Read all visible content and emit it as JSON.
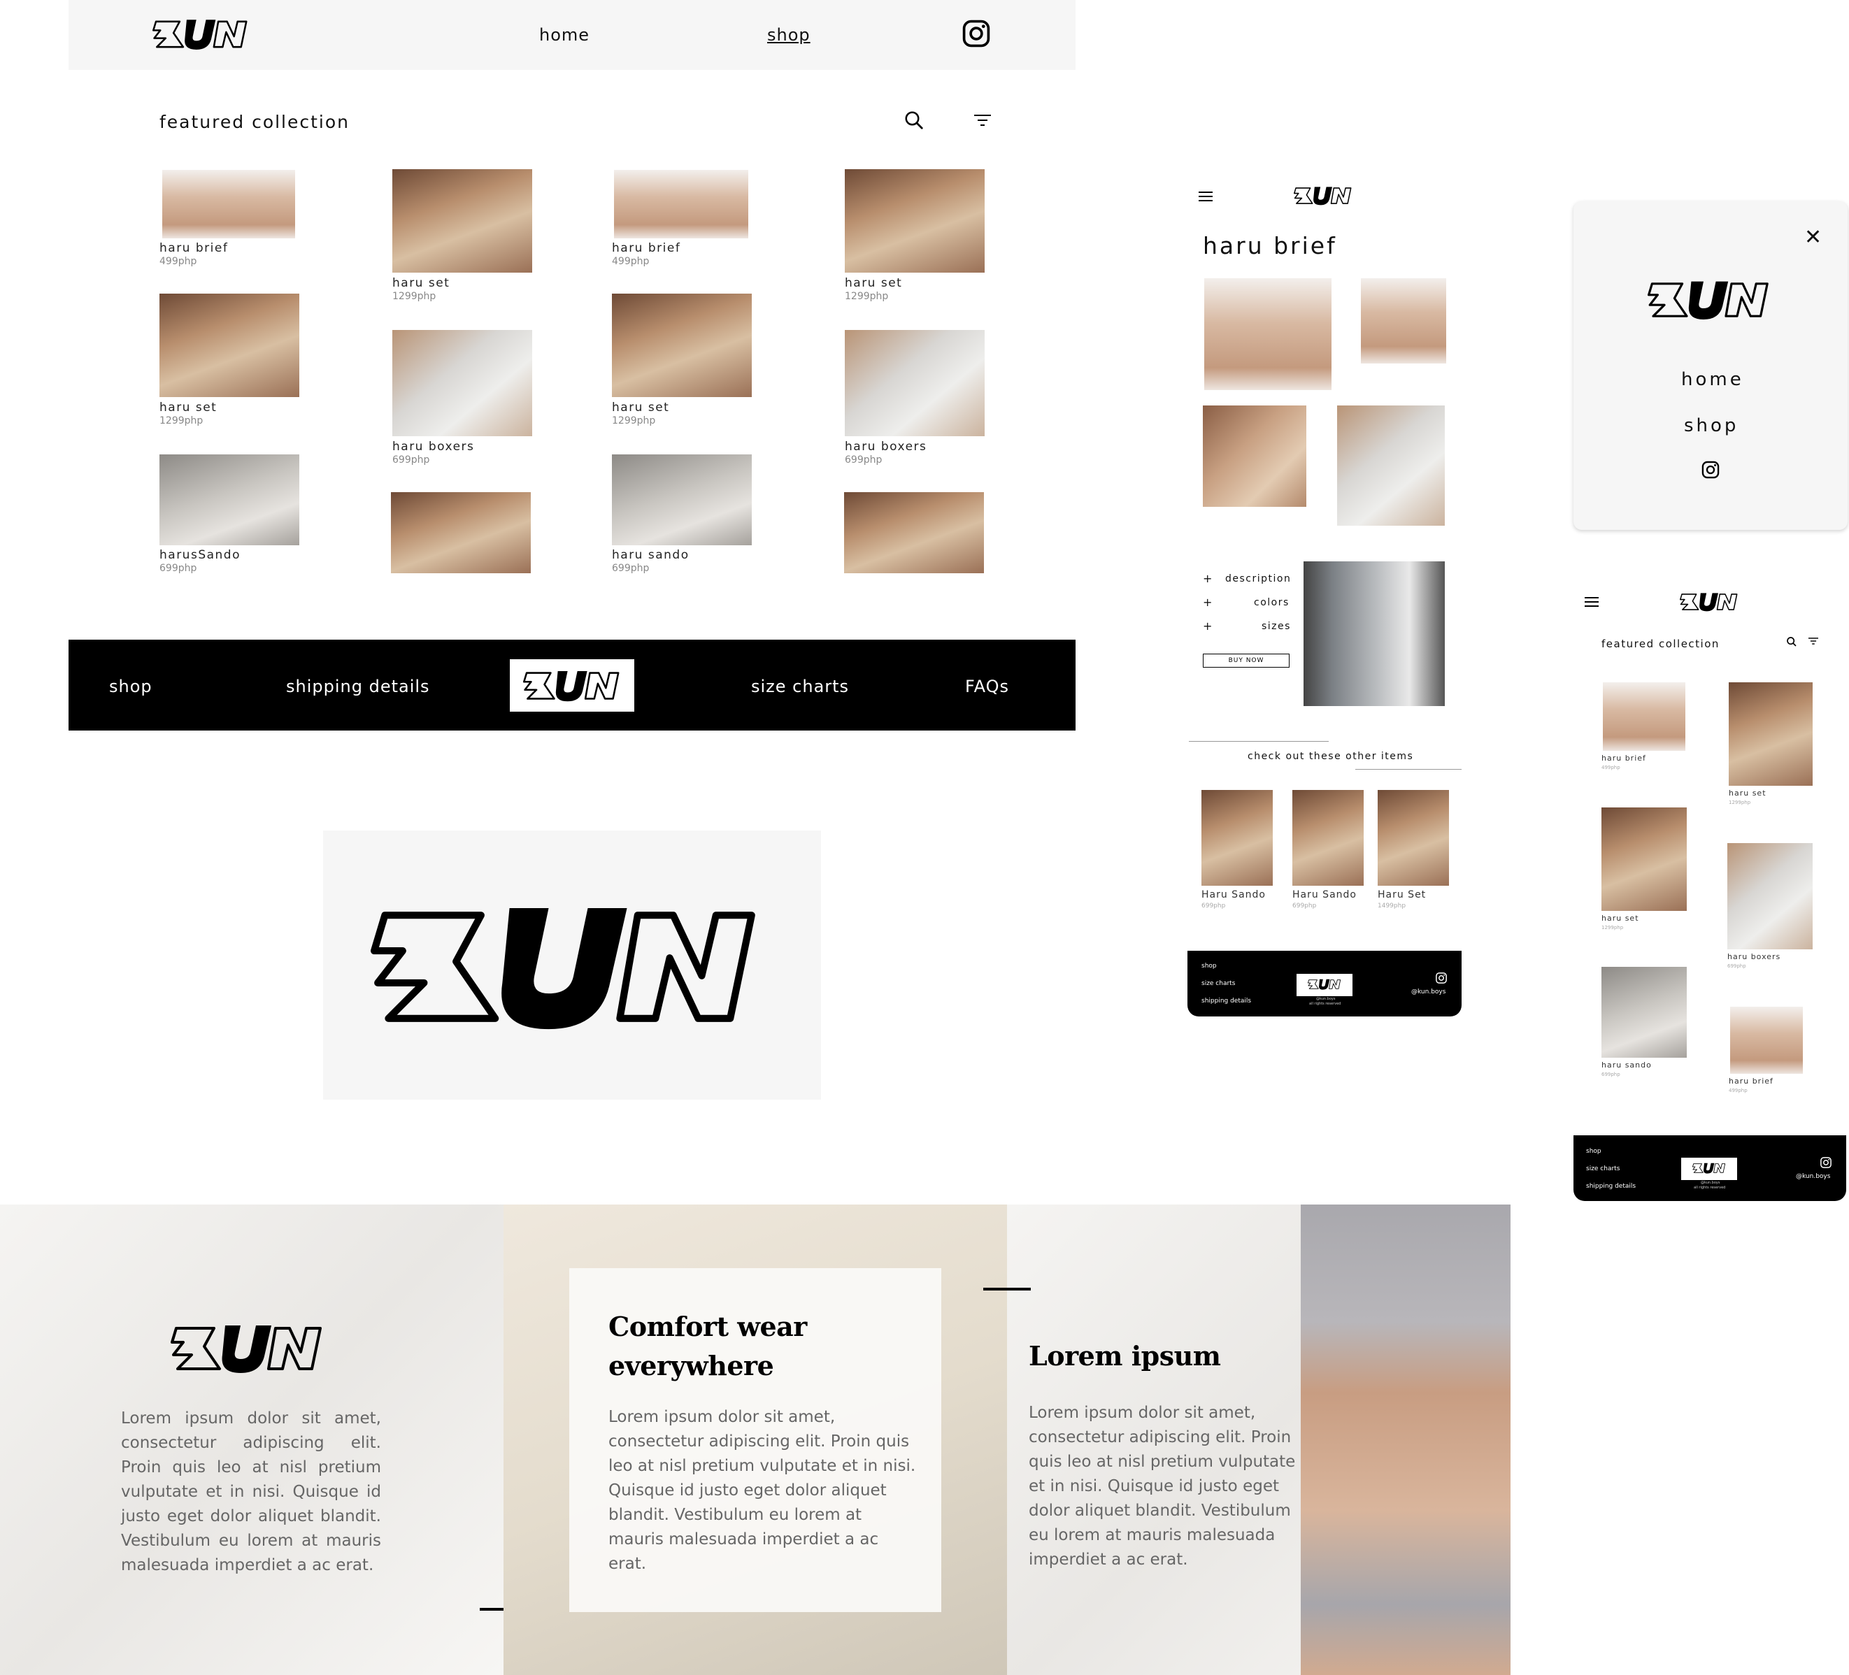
{
  "brand": "KUN",
  "desktop": {
    "nav": {
      "home": "home",
      "shop": "shop"
    },
    "section_title": "featured collection",
    "products": [
      {
        "name": "haru brief",
        "price": "499php"
      },
      {
        "name": "haru set",
        "price": "1299php"
      },
      {
        "name": "haru brief",
        "price": "499php"
      },
      {
        "name": "haru set",
        "price": "1299php"
      },
      {
        "name": "haru set",
        "price": "1299php"
      },
      {
        "name": "haru boxers",
        "price": "699php"
      },
      {
        "name": "haru set",
        "price": "1299php"
      },
      {
        "name": "haru boxers",
        "price": "699php"
      },
      {
        "name": "harusSando",
        "price": "699php"
      },
      {
        "name": "haru sando",
        "price": "699php"
      }
    ],
    "footer": {
      "shop": "shop",
      "shipping": "shipping details",
      "size_charts": "size charts",
      "faqs": "FAQs"
    }
  },
  "product_page": {
    "title": "haru brief",
    "accordion": [
      "description",
      "colors",
      "sizes"
    ],
    "plus": "+",
    "buy_now": "BUY NOW",
    "related_title": "check out these other items",
    "related": [
      {
        "name": "Haru Sando",
        "price": "699php"
      },
      {
        "name": "Haru Sando",
        "price": "699php"
      },
      {
        "name": "Haru Set",
        "price": "1499php"
      }
    ],
    "footer": {
      "shop": "shop",
      "size_charts": "size charts",
      "shipping": "shipping details",
      "handle": "@kun.boys",
      "rights_1": "@kun.boys",
      "rights_2": "all rights reserved"
    }
  },
  "menu": {
    "close": "✕",
    "home": "home",
    "shop": "shop"
  },
  "mobile": {
    "section_title": "featured collection",
    "products": [
      {
        "name": "haru brief",
        "price": "499php"
      },
      {
        "name": "haru set",
        "price": "1299php"
      },
      {
        "name": "haru set",
        "price": "1299php"
      },
      {
        "name": "haru boxers",
        "price": "699php"
      },
      {
        "name": "haru sando",
        "price": "699php"
      },
      {
        "name": "haru brief",
        "price": "499php"
      }
    ],
    "footer": {
      "shop": "shop",
      "size_charts": "size charts",
      "shipping": "shipping details",
      "handle": "@kun.boys",
      "rights_1": "@kun.boys",
      "rights_2": "all rights reserved"
    }
  },
  "banner": {
    "panel1_text": "Lorem ipsum dolor sit amet, consectetur adipiscing elit. Proin quis leo at nisl pretium vulputate et in nisi. Quisque id justo eget dolor aliquet blandit. Vestibulum eu lorem at mauris malesuada imperdiet a ac erat.",
    "panel2_heading_1": "Comfort wear",
    "panel2_heading_2": "everywhere",
    "panel2_text": "Lorem ipsum dolor sit amet, consectetur adipiscing elit. Proin quis leo at nisl pretium vulputate et in nisi. Quisque id justo eget dolor aliquet blandit. Vestibulum eu lorem at mauris malesuada imperdiet a ac erat.",
    "panel3_heading": "Lorem ipsum",
    "panel3_text": "Lorem ipsum dolor sit amet, consectetur adipiscing elit. Proin quis leo at nisl pretium vulputate et in nisi. Quisque id justo eget dolor aliquet blandit. Vestibulum eu lorem at mauris malesuada imperdiet a ac erat."
  },
  "colors": {
    "black": "#000000",
    "light": "#f6f6f6"
  }
}
